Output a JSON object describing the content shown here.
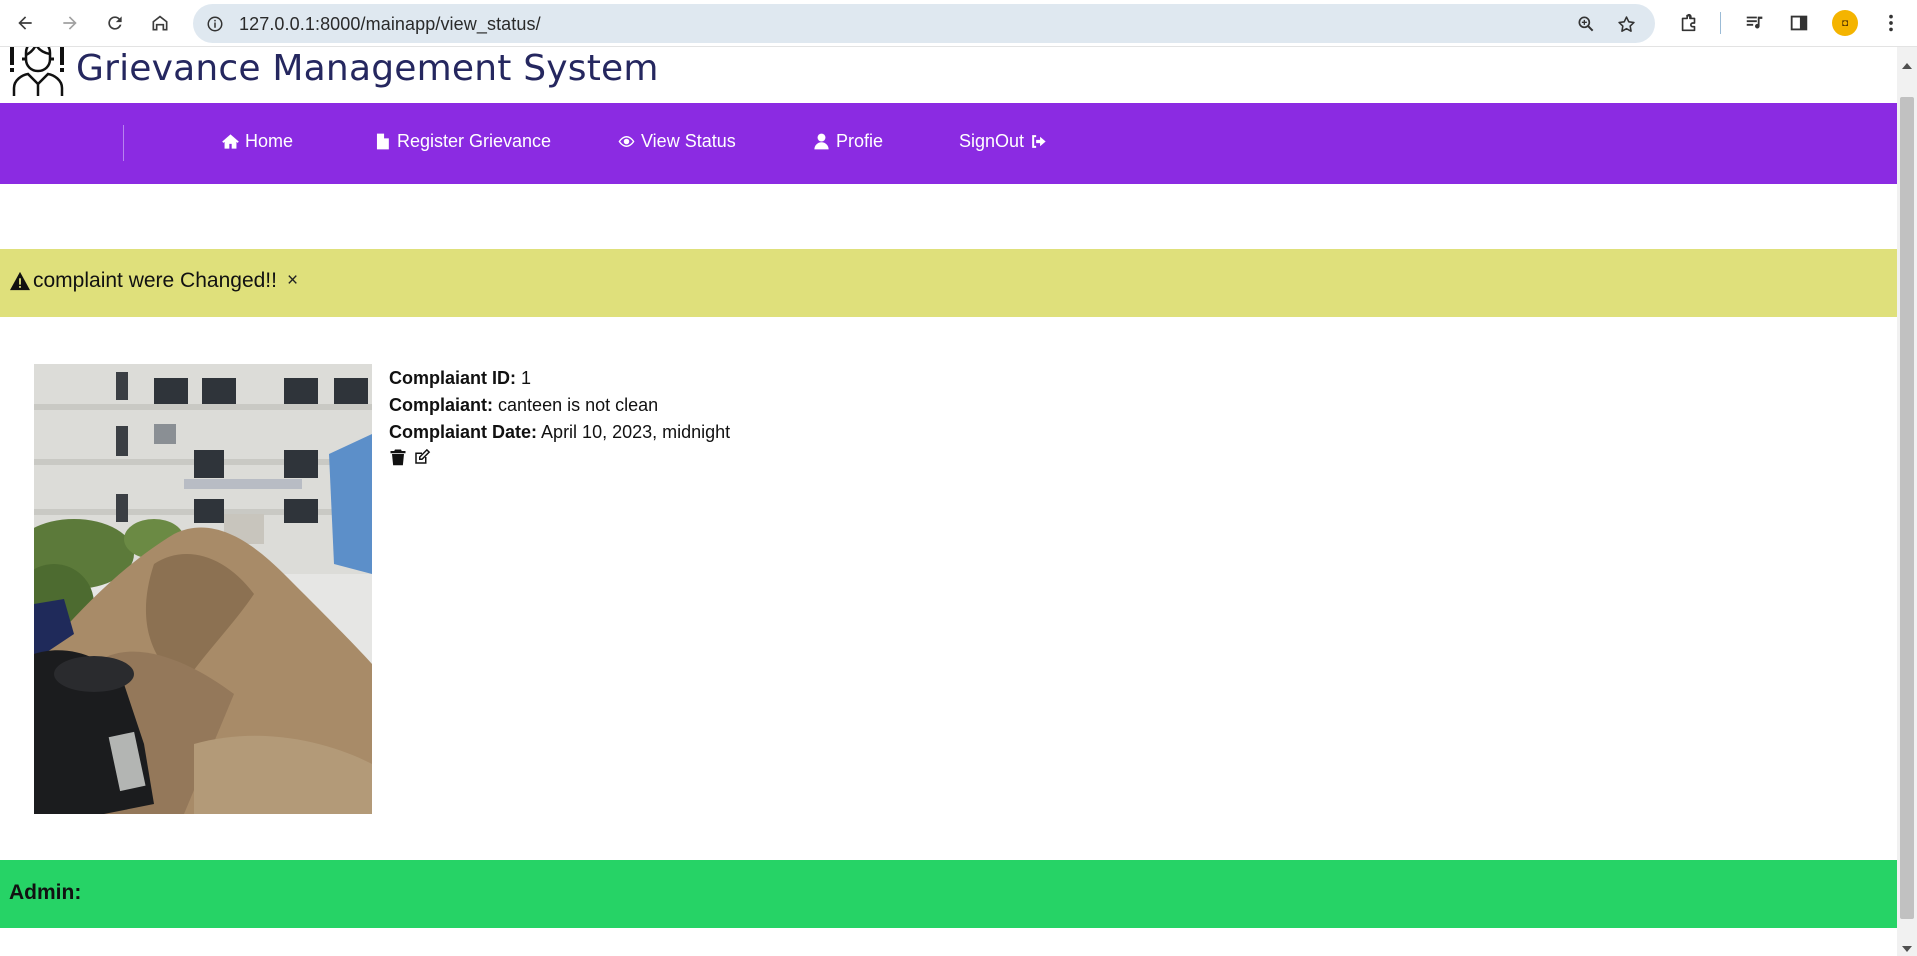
{
  "browser": {
    "url": "127.0.0.1:8000/mainapp/view_status/",
    "icons": [
      "back-arrow-icon",
      "forward-arrow-icon",
      "reload-icon",
      "home-icon",
      "site-info-icon",
      "zoom-icon",
      "bookmark-star-icon",
      "extensions-icon",
      "media-icon",
      "side-panel-icon",
      "profile-avatar-icon",
      "more-menu-icon"
    ]
  },
  "header": {
    "title": "Grievance Management System",
    "logo": "person-with-exclamation-icon"
  },
  "nav": {
    "items": [
      {
        "label": "Home",
        "icon": "home-icon"
      },
      {
        "label": "Register Grievance",
        "icon": "file-icon"
      },
      {
        "label": "View Status",
        "icon": "eye-icon"
      },
      {
        "label": "Profie",
        "icon": "user-icon"
      },
      {
        "label": "SignOut",
        "icon": "sign-out-icon"
      }
    ],
    "color": "#8b2be2"
  },
  "alert": {
    "message": "complaint were Changed!!",
    "close": "×",
    "color": "#dfe07b"
  },
  "complaint": {
    "id_label": "Complaiant ID:",
    "id_value": "1",
    "text_label": "Complaiant:",
    "text_value": "canteen is not clean",
    "date_label": "Complaiant Date:",
    "date_value": "April 10, 2023, midnight",
    "actions": [
      "trash-icon",
      "edit-icon"
    ]
  },
  "admin": {
    "label": "Admin:",
    "color": "#26d366"
  }
}
